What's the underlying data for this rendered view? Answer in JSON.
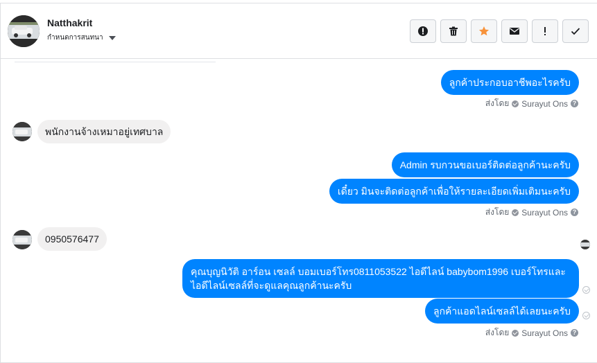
{
  "header": {
    "contact_name": "Natthakrit",
    "status_label": "กำหนดการสนทนา",
    "actions": [
      {
        "name": "report-spam-button",
        "icon": "alert-circle-icon"
      },
      {
        "name": "delete-button",
        "icon": "trash-icon"
      },
      {
        "name": "star-button",
        "icon": "star-icon",
        "color": "#f7923a"
      },
      {
        "name": "mark-unread-button",
        "icon": "envelope-icon"
      },
      {
        "name": "follow-up-button",
        "icon": "exclamation-icon"
      },
      {
        "name": "mark-done-button",
        "icon": "checkmark-icon"
      }
    ]
  },
  "colors": {
    "outgoing_bubble": "#0084ff",
    "incoming_bubble": "#f1f0f0",
    "star_accent": "#f7923a"
  },
  "messages": {
    "out_1": "ลูกค้าประกอบอาชีพอะไรครับ",
    "in_1": "พนักงานจ้างเหมาอยู่เทศบาล",
    "out_2": "Admin รบกวนขอเบอร์ติดต่อลูกค้านะครับ",
    "out_3": "เดี๋ยว มินจะติดต่อลูกค้าเพื่อให้รายละเอียดเพิ่มเติมนะครับ",
    "in_2": "0950576477",
    "out_4_line1": "คุณบุญนิวัติ อาร์อน เซลล์ บอมเบอร์โทร0811053522 ไอดีไลน์ babybom1996  เบอร์โทรและ",
    "out_4_line2": "ไอดีไลน์เซลล์ที่จะดูแลคุณลูกค้านะครับ",
    "out_5": "ลูกค้าแอดไลน์เซลล์ได้เลยนะครับ"
  },
  "sent_by": {
    "prefix": "ส่งโดย",
    "agent": "Surayut Ons"
  }
}
